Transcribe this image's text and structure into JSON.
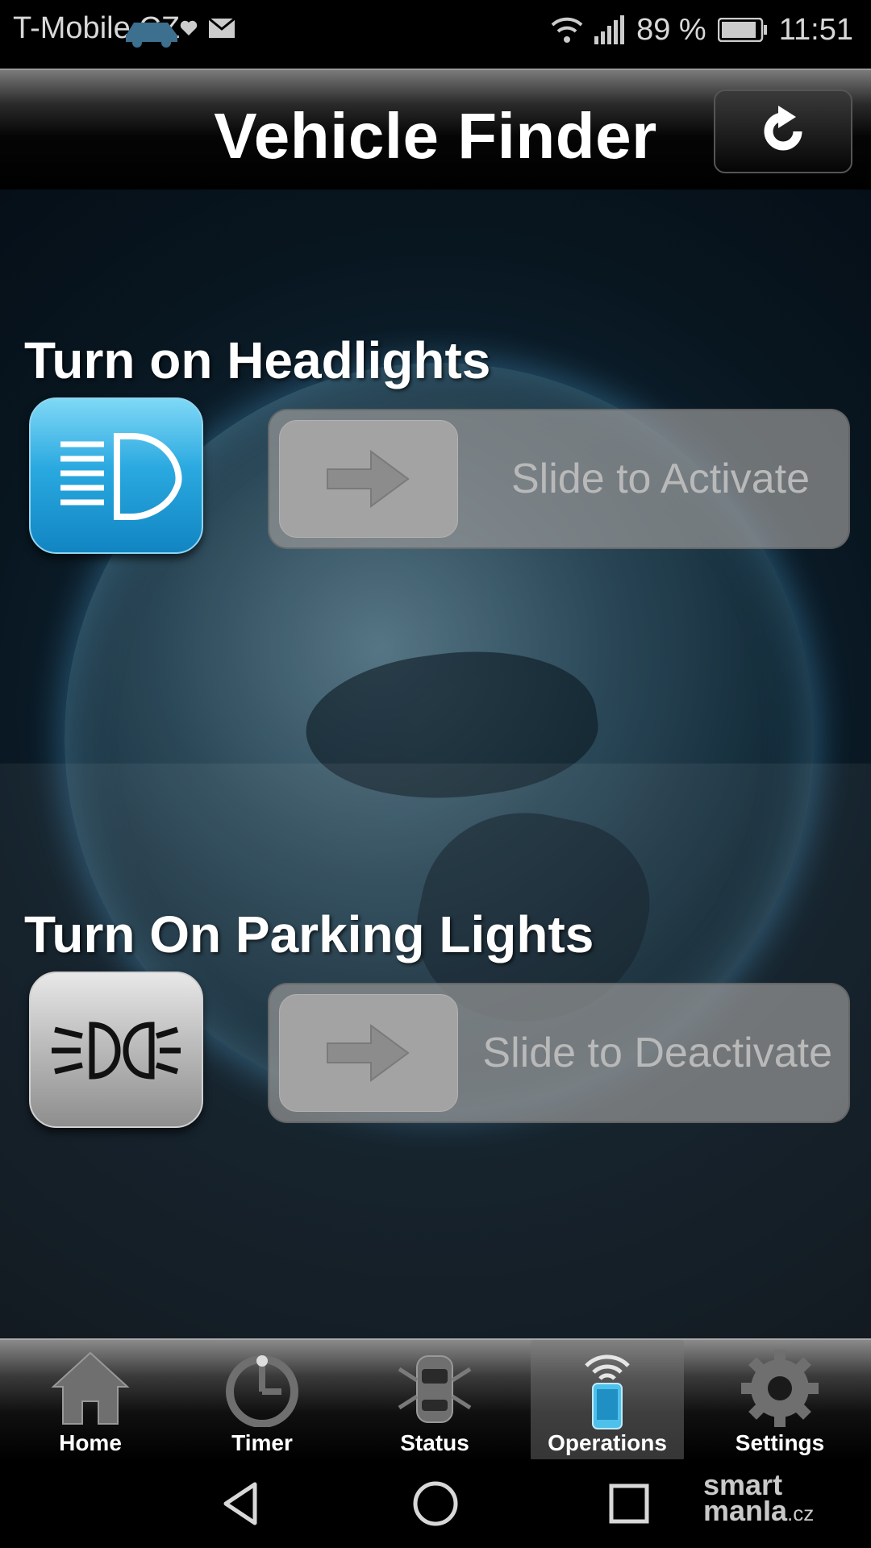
{
  "status_bar": {
    "carrier": "T-Mobile CZ",
    "battery": "89 %",
    "time": "11:51",
    "icons": [
      "car-notification-icon",
      "heart-icon",
      "mail-icon",
      "wifi-icon",
      "signal-icon",
      "battery-icon"
    ]
  },
  "header": {
    "title": "Vehicle Finder",
    "refresh_icon": "refresh-icon"
  },
  "sections": [
    {
      "title": "Turn on Headlights",
      "icon": "headlights-icon",
      "slider_label": "Slide to Activate"
    },
    {
      "title": "Turn On Parking Lights",
      "icon": "parking-lights-icon",
      "slider_label": "Slide to Deactivate"
    }
  ],
  "tabs": [
    {
      "label": "Home",
      "icon": "home-icon",
      "active": false
    },
    {
      "label": "Timer",
      "icon": "timer-icon",
      "active": false
    },
    {
      "label": "Status",
      "icon": "car-status-icon",
      "active": false
    },
    {
      "label": "Operations",
      "icon": "phone-signal-icon",
      "active": true
    },
    {
      "label": "Settings",
      "icon": "gear-icon",
      "active": false
    }
  ],
  "nav": [
    "back-icon",
    "home-circle-icon",
    "recents-icon"
  ],
  "watermark": {
    "line1": "smart",
    "line2": "manIa",
    "suffix": ".cz"
  },
  "colors": {
    "accent_blue": "#2aa9e0",
    "slider_gray": "#969696"
  }
}
